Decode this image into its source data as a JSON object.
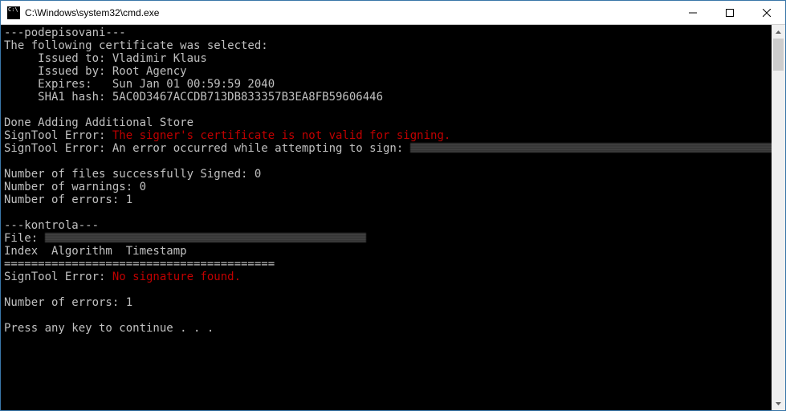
{
  "window": {
    "title": "C:\\Windows\\system32\\cmd.exe"
  },
  "redact": {
    "w1": 520,
    "w2": 400
  },
  "lines": {
    "l0": "---podepisovani---",
    "l1": "The following certificate was selected:",
    "l2": "     Issued to: Vladimir Klaus",
    "l3": "     Issued by: Root Agency",
    "l4": "     Expires:   Sun Jan 01 00:59:59 2040",
    "l5": "     SHA1 hash: 5AC0D3467ACCDB713DB833357B3EA8FB59606446",
    "l6": "",
    "l7": "Done Adding Additional Store",
    "l8a": "SignTool Error: ",
    "l8b": "The signer's certificate is not valid for signing.",
    "l9": "SignTool Error: An error occurred while attempting to sign: ",
    "l10": "",
    "l11": "Number of files successfully Signed: 0",
    "l12": "Number of warnings: 0",
    "l13": "Number of errors: 1",
    "l14": "",
    "l15": "---kontrola---",
    "l16": "File: ",
    "l17": "Index  Algorithm  Timestamp",
    "l18": "========================================",
    "l19a": "SignTool Error: ",
    "l19b": "No signature found.",
    "l20": "",
    "l21": "Number of errors: 1",
    "l22": "",
    "l23": "Press any key to continue . . ."
  }
}
